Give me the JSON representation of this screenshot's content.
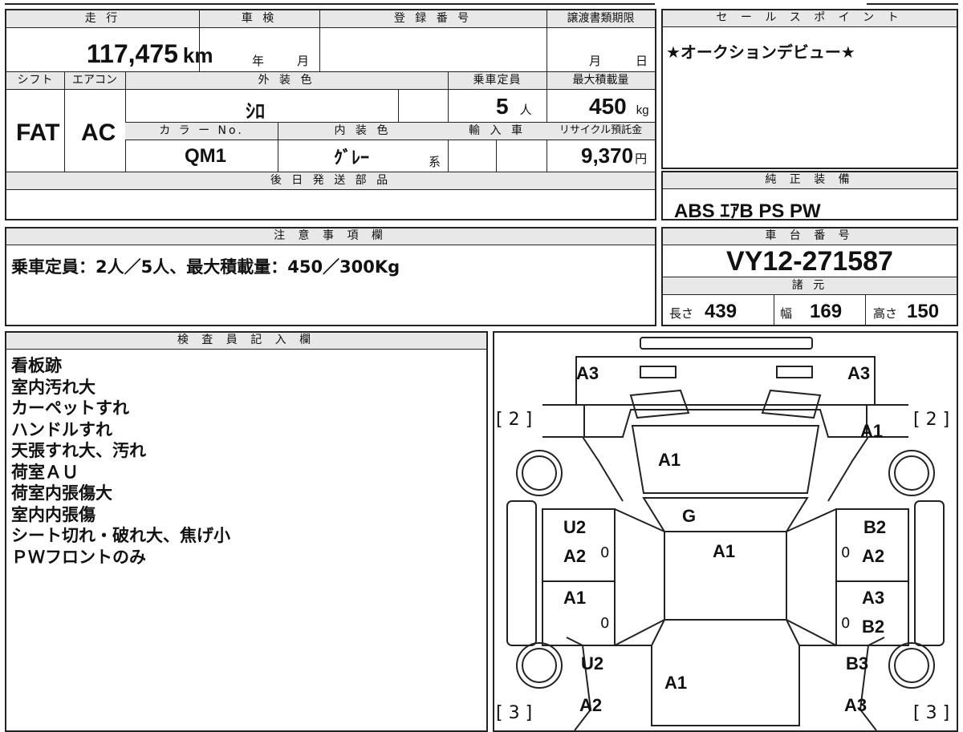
{
  "top_table": {
    "mileage_label": "走 行",
    "mileage_value": "117,475",
    "mileage_unit": "km",
    "inspection_label": "車 検",
    "inspection_year_unit": "年",
    "inspection_month_unit": "月",
    "registration_label": "登 録 番 号",
    "transfer_label": "譲渡書類期限",
    "transfer_month_unit": "月",
    "transfer_day_unit": "日",
    "shift_label": "シフト",
    "shift_value": "FAT",
    "aircon_label": "エアコン",
    "aircon_value": "AC",
    "exterior_label": "外 装 色",
    "exterior_value": "ｼﾛ",
    "capacity_label": "乗車定員",
    "capacity_value": "5",
    "capacity_unit": "人",
    "maxload_label": "最大積載量",
    "maxload_value": "450",
    "maxload_unit": "kg",
    "color_no_label": "カ ラ ー No.",
    "color_no_value": "QM1",
    "interior_label": "内 装 色",
    "interior_value": "ｸﾞﾚｰ",
    "interior_suffix": "系",
    "import_label": "輸 入 車",
    "recycle_label": "リサイクル預託金",
    "recycle_value": "9,370",
    "recycle_unit": "円",
    "later_parts_label": "後 日 発 送 部 品"
  },
  "sales_point": {
    "label": "セ ー ル ス ポ イ ン ト",
    "text": "★オークションデビュー★"
  },
  "equipment": {
    "label": "純 正 装 備",
    "text": "ABS ｴｱB PS PW"
  },
  "notes": {
    "label": "注 意 事 項 欄",
    "text": "乗車定員：2人／5人、最大積載量：450／300Kg"
  },
  "chassis": {
    "label": "車 台 番 号",
    "value": "VY12-271587",
    "specs_label": "諸 元",
    "length_label": "長さ",
    "length_value": "439",
    "width_label": "幅",
    "width_value": "169",
    "height_label": "高さ",
    "height_value": "150"
  },
  "inspector": {
    "label": "検 査 員 記 入 欄",
    "lines": [
      "看板跡",
      "室内汚れ大",
      "カーペットすれ",
      "ハンドルすれ",
      "天張すれ大、汚れ",
      "荷室ＡＵ",
      "荷室内張傷大",
      "室内内張傷",
      "シート切れ・破れ大、焦げ小",
      "ＰＷフロントのみ"
    ]
  },
  "diagram": {
    "marks": {
      "front_left": "A3",
      "front_right": "A3",
      "tire_fl": "[ 2 ]",
      "tire_fr": "[ 2 ]",
      "tire_rl": "[ 3 ]",
      "tire_rr": "[ 3 ]",
      "fender_fr": "A1",
      "hood": "A1",
      "windshield": "G",
      "roof": "A1",
      "door_fl_top": "U2",
      "door_fl_bottom": "A2",
      "door_fr_top": "B2",
      "door_fr_bottom": "A2",
      "door_rl": "A1",
      "door_rr_top": "A3",
      "door_rr_bottom": "B2",
      "zero_1": "0",
      "zero_2": "0",
      "zero_3": "0",
      "zero_4": "0",
      "quarter_rl": "U2",
      "quarter_rr": "B3",
      "rear_body": "A1",
      "rear_left": "A2",
      "rear_right": "A3"
    }
  }
}
